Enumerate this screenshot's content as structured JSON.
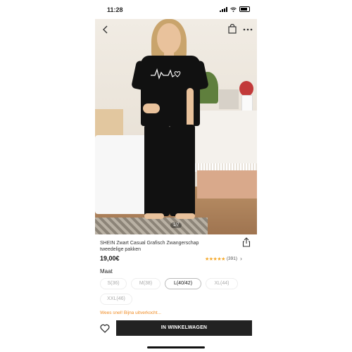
{
  "status_bar": {
    "time": "11:28"
  },
  "product": {
    "title": "SHEIN Zwart Casual Grafisch Zwangerschap tweedelige pakken",
    "price": "19,00€",
    "rating_stars": "★★★★★",
    "reviews": "(391)",
    "pager": "1/7",
    "print_text": "ʌʌ∿♡"
  },
  "sizes": {
    "label": "Maat",
    "options": [
      "S(36)",
      "M(38)",
      "L(40/42)",
      "XL(44)",
      "XXL(46)"
    ],
    "selected": "L(40/42)"
  },
  "notice": "Wees snel! Bijna uitverkocht...",
  "cta_label": "IN WINKELWAGEN",
  "colors": {
    "accent_orange": "#f08b22",
    "star": "#f5a623",
    "cta_bg": "#222222"
  }
}
